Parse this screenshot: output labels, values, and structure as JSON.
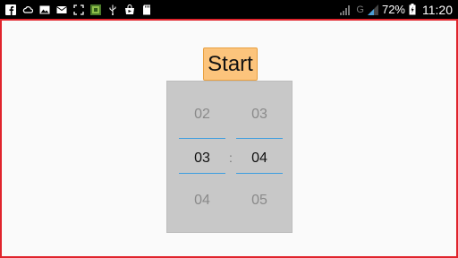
{
  "status_bar": {
    "battery_percent": "72%",
    "clock": "11:20",
    "network": "G",
    "left_icons": [
      "facebook-icon",
      "cloud-icon",
      "image-icon",
      "mail-icon",
      "screenshot-icon",
      "app-icon",
      "usb-icon",
      "store-icon",
      "sd-card-icon"
    ],
    "right_icons": [
      "signal-icon",
      "signal-icon",
      "battery-icon"
    ]
  },
  "app": {
    "start_label": "Start",
    "colors": {
      "accent_border": "#e0242c",
      "button_bg": "#fcc47c",
      "divider": "#3d9ee0"
    }
  },
  "time_picker": {
    "hours": {
      "prev": "02",
      "current": "03",
      "next": "04"
    },
    "minutes": {
      "prev": "03",
      "current": "04",
      "next": "05"
    },
    "separator": ":"
  }
}
